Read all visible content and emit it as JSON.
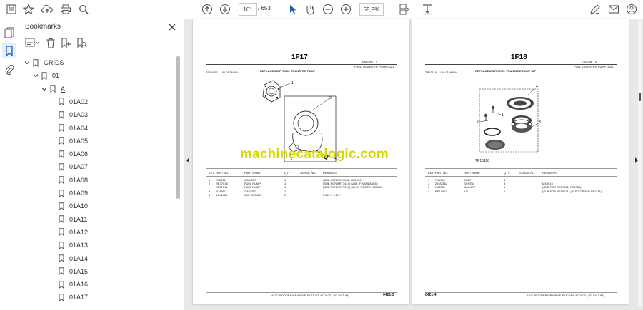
{
  "toolbar": {
    "page_current": "161",
    "page_sep": "/",
    "page_total": "653",
    "zoom": "55,9%"
  },
  "panel": {
    "title": "Bookmarks"
  },
  "bookmarks": [
    {
      "label": "GRIDS"
    },
    {
      "label": "01"
    },
    {
      "label": "A"
    },
    {
      "label": "01A02"
    },
    {
      "label": "01A03"
    },
    {
      "label": "01A04"
    },
    {
      "label": "01A05"
    },
    {
      "label": "01A06"
    },
    {
      "label": "01A07"
    },
    {
      "label": "01A08"
    },
    {
      "label": "01A09"
    },
    {
      "label": "01A10"
    },
    {
      "label": "01A11"
    },
    {
      "label": "01A12"
    },
    {
      "label": "01A13"
    },
    {
      "label": "01A14"
    },
    {
      "label": "01A15"
    },
    {
      "label": "01A16"
    },
    {
      "label": "01A17"
    }
  ],
  "page_left": {
    "grid": "1F17",
    "section": "ENGINE",
    "section_num": "4",
    "subsection": "FUEL TRANSFER PUMP",
    "subsection_code": "0421",
    "heading": "REPLACEMENT FUEL TRANSFER PUMP",
    "code_left": "TP14402",
    "code_mid": "-UN-01JAN94",
    "col_headers": [
      "KEY",
      "PART NO.",
      "PART NAME",
      "QTY",
      "SERIAL NO.",
      "REMARKS"
    ],
    "rows": [
      [
        "1",
        "R52411",
        "GASKET",
        "1",
        "",
        "(SUB FOR RE17341, RE1000)"
      ],
      [
        "2",
        "RE77013",
        "FUEL PUMP",
        "1",
        "",
        "(SUB FOR AR77414) (USE IF AVAILABLE)"
      ],
      [
        "",
        "RE57011",
        "FUEL PUMP",
        "1",
        "",
        "(SUB FOR RE77013) (ALSO ORDER R32081)"
      ],
      [
        "3",
        "R74361",
        "GASKET",
        "1",
        "",
        ""
      ],
      [
        "4",
        "19H1066",
        "CAP SCREW",
        "2",
        "",
        "5/16\" X 1-1/4\""
      ]
    ],
    "footer": "440C SKIDDER/GRAPPLE SKIDDER PC1623",
    "footer_date": "(03-OCT-94)",
    "page_code": "0421-3"
  },
  "page_right": {
    "grid": "1F18",
    "section": "ENGINE",
    "section_num": "4",
    "subsection": "FUEL TRANSFER PUMP",
    "subsection_code": "0421",
    "heading": "REPLACEMENT FUEL TRANSFER PUMP KIT",
    "code_left": "TP13116",
    "code_mid": "-UN-01JAN94",
    "fig_label": "TP13116",
    "col_headers": [
      "KEY",
      "PART NO.",
      "PART NAME",
      "QTY",
      "SERIAL NO.",
      "REMARKS"
    ],
    "rows": [
      [
        "1",
        "P46960",
        "BOLT",
        "3",
        "",
        ""
      ],
      [
        "2",
        "27M7332",
        "SCREW",
        "3",
        "",
        "M5 X 16"
      ],
      [
        "3",
        "R43531",
        "GASKET",
        "1",
        "",
        "(SUB FOR RE17341, R27336)"
      ],
      [
        "4",
        "RE10017",
        "KIT",
        "1",
        "",
        "(SUB FOR RE50171) (ALSO ORDER R52411)"
      ]
    ],
    "footer": "440C SKIDDER/GRAPPLE SKIDDER PC1623",
    "footer_date": "(03-OCT-94)",
    "page_code": "0421-4"
  },
  "watermark": "machinecatalogic.com"
}
